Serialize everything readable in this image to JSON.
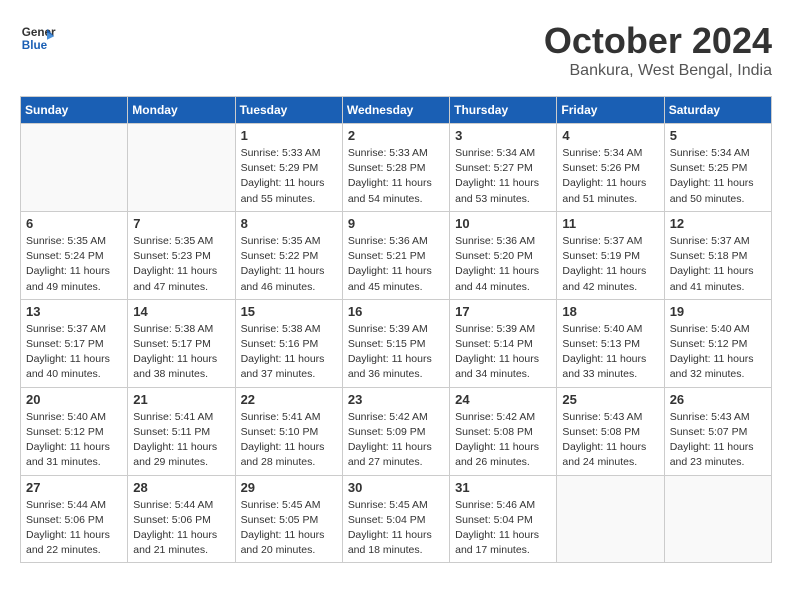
{
  "header": {
    "logo_line1": "General",
    "logo_line2": "Blue",
    "month": "October 2024",
    "location": "Bankura, West Bengal, India"
  },
  "weekdays": [
    "Sunday",
    "Monday",
    "Tuesday",
    "Wednesday",
    "Thursday",
    "Friday",
    "Saturday"
  ],
  "weeks": [
    [
      {
        "day": "",
        "info": ""
      },
      {
        "day": "",
        "info": ""
      },
      {
        "day": "1",
        "info": "Sunrise: 5:33 AM\nSunset: 5:29 PM\nDaylight: 11 hours and 55 minutes."
      },
      {
        "day": "2",
        "info": "Sunrise: 5:33 AM\nSunset: 5:28 PM\nDaylight: 11 hours and 54 minutes."
      },
      {
        "day": "3",
        "info": "Sunrise: 5:34 AM\nSunset: 5:27 PM\nDaylight: 11 hours and 53 minutes."
      },
      {
        "day": "4",
        "info": "Sunrise: 5:34 AM\nSunset: 5:26 PM\nDaylight: 11 hours and 51 minutes."
      },
      {
        "day": "5",
        "info": "Sunrise: 5:34 AM\nSunset: 5:25 PM\nDaylight: 11 hours and 50 minutes."
      }
    ],
    [
      {
        "day": "6",
        "info": "Sunrise: 5:35 AM\nSunset: 5:24 PM\nDaylight: 11 hours and 49 minutes."
      },
      {
        "day": "7",
        "info": "Sunrise: 5:35 AM\nSunset: 5:23 PM\nDaylight: 11 hours and 47 minutes."
      },
      {
        "day": "8",
        "info": "Sunrise: 5:35 AM\nSunset: 5:22 PM\nDaylight: 11 hours and 46 minutes."
      },
      {
        "day": "9",
        "info": "Sunrise: 5:36 AM\nSunset: 5:21 PM\nDaylight: 11 hours and 45 minutes."
      },
      {
        "day": "10",
        "info": "Sunrise: 5:36 AM\nSunset: 5:20 PM\nDaylight: 11 hours and 44 minutes."
      },
      {
        "day": "11",
        "info": "Sunrise: 5:37 AM\nSunset: 5:19 PM\nDaylight: 11 hours and 42 minutes."
      },
      {
        "day": "12",
        "info": "Sunrise: 5:37 AM\nSunset: 5:18 PM\nDaylight: 11 hours and 41 minutes."
      }
    ],
    [
      {
        "day": "13",
        "info": "Sunrise: 5:37 AM\nSunset: 5:17 PM\nDaylight: 11 hours and 40 minutes."
      },
      {
        "day": "14",
        "info": "Sunrise: 5:38 AM\nSunset: 5:17 PM\nDaylight: 11 hours and 38 minutes."
      },
      {
        "day": "15",
        "info": "Sunrise: 5:38 AM\nSunset: 5:16 PM\nDaylight: 11 hours and 37 minutes."
      },
      {
        "day": "16",
        "info": "Sunrise: 5:39 AM\nSunset: 5:15 PM\nDaylight: 11 hours and 36 minutes."
      },
      {
        "day": "17",
        "info": "Sunrise: 5:39 AM\nSunset: 5:14 PM\nDaylight: 11 hours and 34 minutes."
      },
      {
        "day": "18",
        "info": "Sunrise: 5:40 AM\nSunset: 5:13 PM\nDaylight: 11 hours and 33 minutes."
      },
      {
        "day": "19",
        "info": "Sunrise: 5:40 AM\nSunset: 5:12 PM\nDaylight: 11 hours and 32 minutes."
      }
    ],
    [
      {
        "day": "20",
        "info": "Sunrise: 5:40 AM\nSunset: 5:12 PM\nDaylight: 11 hours and 31 minutes."
      },
      {
        "day": "21",
        "info": "Sunrise: 5:41 AM\nSunset: 5:11 PM\nDaylight: 11 hours and 29 minutes."
      },
      {
        "day": "22",
        "info": "Sunrise: 5:41 AM\nSunset: 5:10 PM\nDaylight: 11 hours and 28 minutes."
      },
      {
        "day": "23",
        "info": "Sunrise: 5:42 AM\nSunset: 5:09 PM\nDaylight: 11 hours and 27 minutes."
      },
      {
        "day": "24",
        "info": "Sunrise: 5:42 AM\nSunset: 5:08 PM\nDaylight: 11 hours and 26 minutes."
      },
      {
        "day": "25",
        "info": "Sunrise: 5:43 AM\nSunset: 5:08 PM\nDaylight: 11 hours and 24 minutes."
      },
      {
        "day": "26",
        "info": "Sunrise: 5:43 AM\nSunset: 5:07 PM\nDaylight: 11 hours and 23 minutes."
      }
    ],
    [
      {
        "day": "27",
        "info": "Sunrise: 5:44 AM\nSunset: 5:06 PM\nDaylight: 11 hours and 22 minutes."
      },
      {
        "day": "28",
        "info": "Sunrise: 5:44 AM\nSunset: 5:06 PM\nDaylight: 11 hours and 21 minutes."
      },
      {
        "day": "29",
        "info": "Sunrise: 5:45 AM\nSunset: 5:05 PM\nDaylight: 11 hours and 20 minutes."
      },
      {
        "day": "30",
        "info": "Sunrise: 5:45 AM\nSunset: 5:04 PM\nDaylight: 11 hours and 18 minutes."
      },
      {
        "day": "31",
        "info": "Sunrise: 5:46 AM\nSunset: 5:04 PM\nDaylight: 11 hours and 17 minutes."
      },
      {
        "day": "",
        "info": ""
      },
      {
        "day": "",
        "info": ""
      }
    ]
  ]
}
